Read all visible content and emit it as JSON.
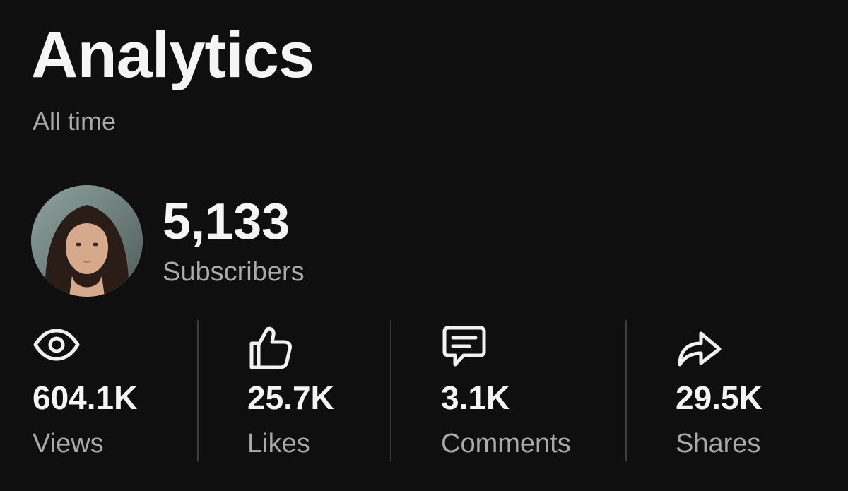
{
  "header": {
    "title": "Analytics",
    "period": "All time"
  },
  "channel": {
    "avatar_icon": "profile-photo",
    "subscribers_count": "5,133",
    "subscribers_label": "Subscribers"
  },
  "stats": [
    {
      "icon": "eye-icon",
      "value": "604.1K",
      "label": "Views"
    },
    {
      "icon": "thumbs-up-icon",
      "value": "25.7K",
      "label": "Likes"
    },
    {
      "icon": "comment-icon",
      "value": "3.1K",
      "label": "Comments"
    },
    {
      "icon": "share-icon",
      "value": "29.5K",
      "label": "Shares"
    }
  ],
  "colors": {
    "background": "#0f0f0f",
    "text_primary": "#f1f1f1",
    "text_secondary": "#aaaaaa",
    "divider": "#3d3d3d"
  }
}
